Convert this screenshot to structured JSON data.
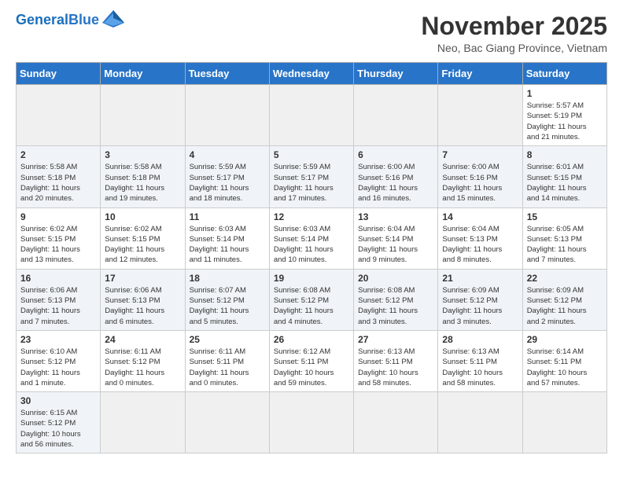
{
  "header": {
    "logo_general": "General",
    "logo_blue": "Blue",
    "month_title": "November 2025",
    "subtitle": "Neo, Bac Giang Province, Vietnam"
  },
  "weekdays": [
    "Sunday",
    "Monday",
    "Tuesday",
    "Wednesday",
    "Thursday",
    "Friday",
    "Saturday"
  ],
  "weeks": [
    [
      {
        "day": "",
        "info": ""
      },
      {
        "day": "",
        "info": ""
      },
      {
        "day": "",
        "info": ""
      },
      {
        "day": "",
        "info": ""
      },
      {
        "day": "",
        "info": ""
      },
      {
        "day": "",
        "info": ""
      },
      {
        "day": "1",
        "info": "Sunrise: 5:57 AM\nSunset: 5:19 PM\nDaylight: 11 hours\nand 21 minutes."
      }
    ],
    [
      {
        "day": "2",
        "info": "Sunrise: 5:58 AM\nSunset: 5:18 PM\nDaylight: 11 hours\nand 20 minutes."
      },
      {
        "day": "3",
        "info": "Sunrise: 5:58 AM\nSunset: 5:18 PM\nDaylight: 11 hours\nand 19 minutes."
      },
      {
        "day": "4",
        "info": "Sunrise: 5:59 AM\nSunset: 5:17 PM\nDaylight: 11 hours\nand 18 minutes."
      },
      {
        "day": "5",
        "info": "Sunrise: 5:59 AM\nSunset: 5:17 PM\nDaylight: 11 hours\nand 17 minutes."
      },
      {
        "day": "6",
        "info": "Sunrise: 6:00 AM\nSunset: 5:16 PM\nDaylight: 11 hours\nand 16 minutes."
      },
      {
        "day": "7",
        "info": "Sunrise: 6:00 AM\nSunset: 5:16 PM\nDaylight: 11 hours\nand 15 minutes."
      },
      {
        "day": "8",
        "info": "Sunrise: 6:01 AM\nSunset: 5:15 PM\nDaylight: 11 hours\nand 14 minutes."
      }
    ],
    [
      {
        "day": "9",
        "info": "Sunrise: 6:02 AM\nSunset: 5:15 PM\nDaylight: 11 hours\nand 13 minutes."
      },
      {
        "day": "10",
        "info": "Sunrise: 6:02 AM\nSunset: 5:15 PM\nDaylight: 11 hours\nand 12 minutes."
      },
      {
        "day": "11",
        "info": "Sunrise: 6:03 AM\nSunset: 5:14 PM\nDaylight: 11 hours\nand 11 minutes."
      },
      {
        "day": "12",
        "info": "Sunrise: 6:03 AM\nSunset: 5:14 PM\nDaylight: 11 hours\nand 10 minutes."
      },
      {
        "day": "13",
        "info": "Sunrise: 6:04 AM\nSunset: 5:14 PM\nDaylight: 11 hours\nand 9 minutes."
      },
      {
        "day": "14",
        "info": "Sunrise: 6:04 AM\nSunset: 5:13 PM\nDaylight: 11 hours\nand 8 minutes."
      },
      {
        "day": "15",
        "info": "Sunrise: 6:05 AM\nSunset: 5:13 PM\nDaylight: 11 hours\nand 7 minutes."
      }
    ],
    [
      {
        "day": "16",
        "info": "Sunrise: 6:06 AM\nSunset: 5:13 PM\nDaylight: 11 hours\nand 7 minutes."
      },
      {
        "day": "17",
        "info": "Sunrise: 6:06 AM\nSunset: 5:13 PM\nDaylight: 11 hours\nand 6 minutes."
      },
      {
        "day": "18",
        "info": "Sunrise: 6:07 AM\nSunset: 5:12 PM\nDaylight: 11 hours\nand 5 minutes."
      },
      {
        "day": "19",
        "info": "Sunrise: 6:08 AM\nSunset: 5:12 PM\nDaylight: 11 hours\nand 4 minutes."
      },
      {
        "day": "20",
        "info": "Sunrise: 6:08 AM\nSunset: 5:12 PM\nDaylight: 11 hours\nand 3 minutes."
      },
      {
        "day": "21",
        "info": "Sunrise: 6:09 AM\nSunset: 5:12 PM\nDaylight: 11 hours\nand 3 minutes."
      },
      {
        "day": "22",
        "info": "Sunrise: 6:09 AM\nSunset: 5:12 PM\nDaylight: 11 hours\nand 2 minutes."
      }
    ],
    [
      {
        "day": "23",
        "info": "Sunrise: 6:10 AM\nSunset: 5:12 PM\nDaylight: 11 hours\nand 1 minute."
      },
      {
        "day": "24",
        "info": "Sunrise: 6:11 AM\nSunset: 5:12 PM\nDaylight: 11 hours\nand 0 minutes."
      },
      {
        "day": "25",
        "info": "Sunrise: 6:11 AM\nSunset: 5:11 PM\nDaylight: 11 hours\nand 0 minutes."
      },
      {
        "day": "26",
        "info": "Sunrise: 6:12 AM\nSunset: 5:11 PM\nDaylight: 10 hours\nand 59 minutes."
      },
      {
        "day": "27",
        "info": "Sunrise: 6:13 AM\nSunset: 5:11 PM\nDaylight: 10 hours\nand 58 minutes."
      },
      {
        "day": "28",
        "info": "Sunrise: 6:13 AM\nSunset: 5:11 PM\nDaylight: 10 hours\nand 58 minutes."
      },
      {
        "day": "29",
        "info": "Sunrise: 6:14 AM\nSunset: 5:11 PM\nDaylight: 10 hours\nand 57 minutes."
      }
    ],
    [
      {
        "day": "30",
        "info": "Sunrise: 6:15 AM\nSunset: 5:12 PM\nDaylight: 10 hours\nand 56 minutes."
      },
      {
        "day": "",
        "info": ""
      },
      {
        "day": "",
        "info": ""
      },
      {
        "day": "",
        "info": ""
      },
      {
        "day": "",
        "info": ""
      },
      {
        "day": "",
        "info": ""
      },
      {
        "day": "",
        "info": ""
      }
    ]
  ]
}
